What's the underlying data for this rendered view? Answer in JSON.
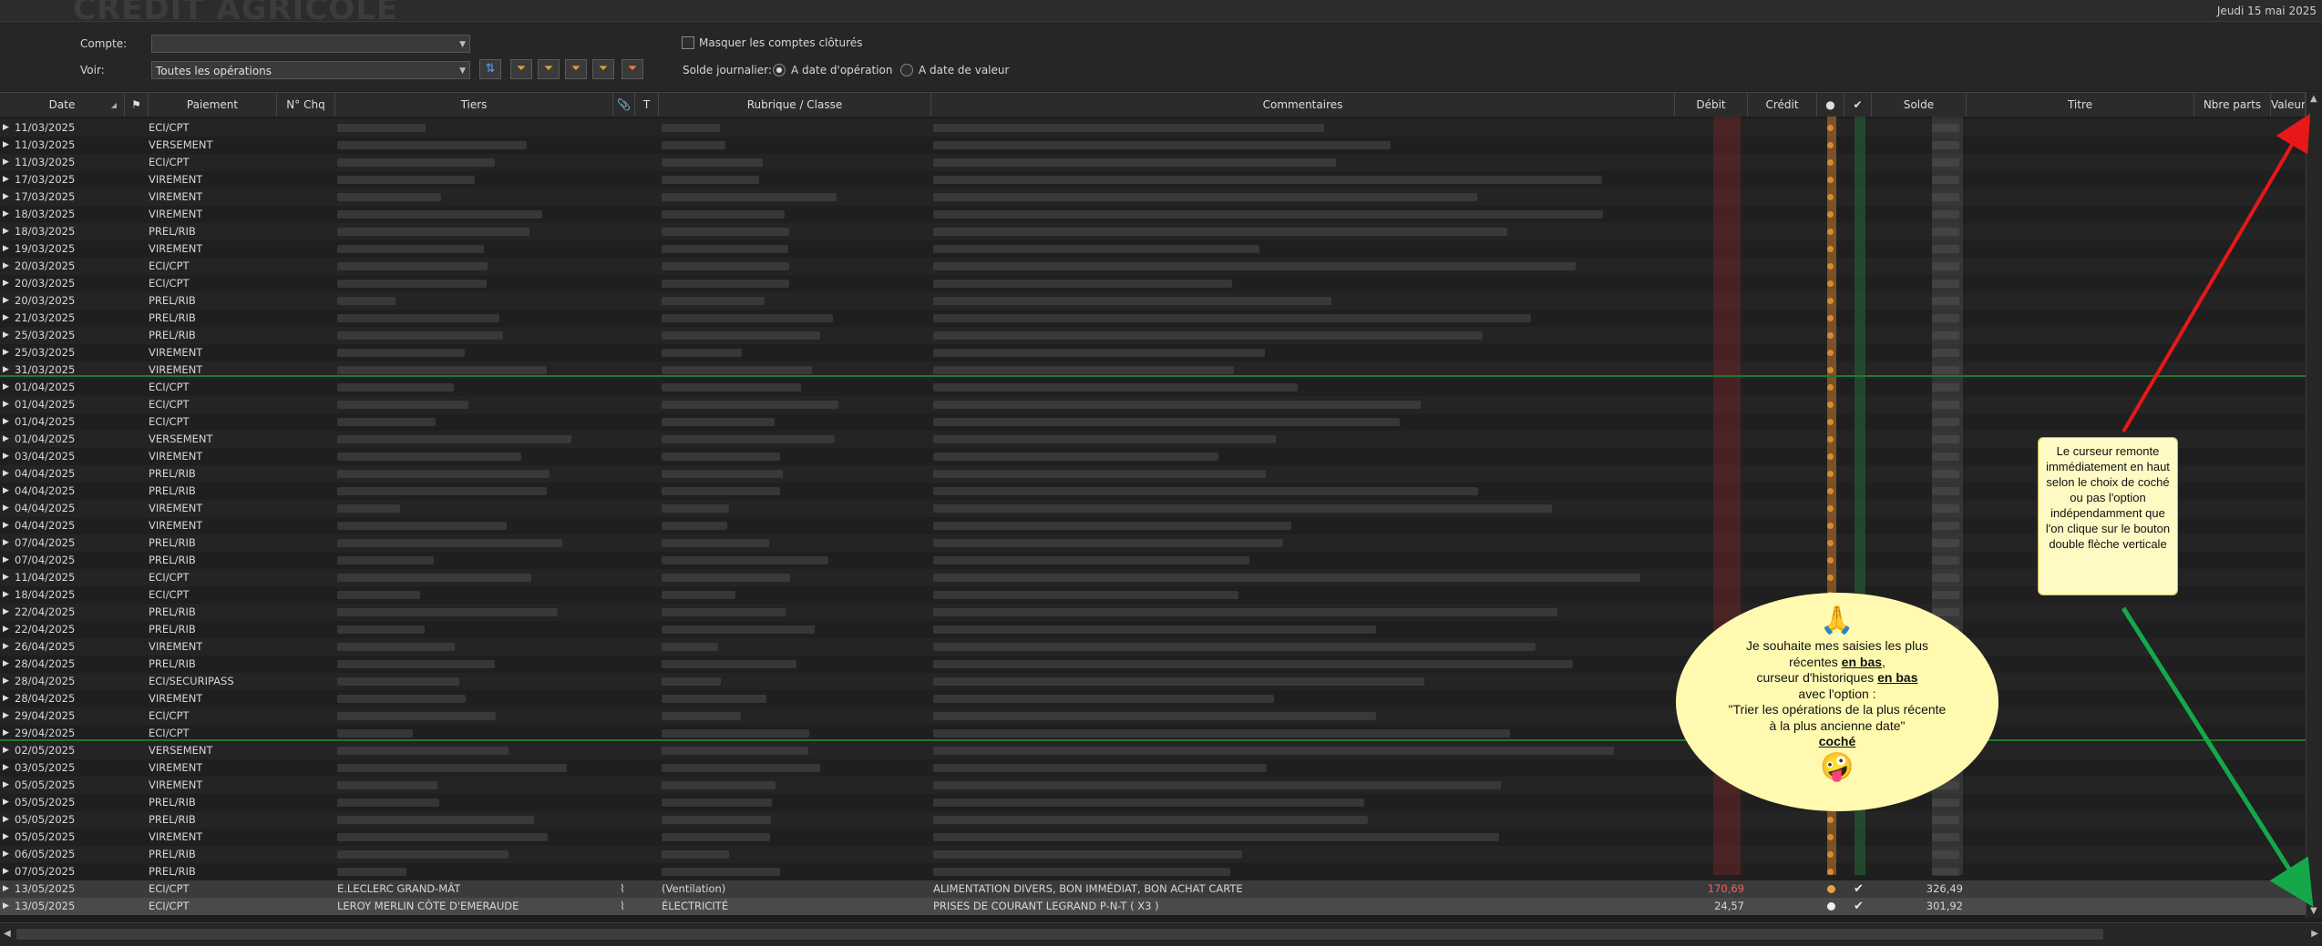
{
  "topbar": {
    "date": "Jeudi 15 mai 2025",
    "watermark": "CRÉDIT AGRICOLE"
  },
  "filters": {
    "compte_label": "Compte:",
    "compte_value": "",
    "voir_label": "Voir:",
    "voir_value": "Toutes les opérations",
    "masquer_label": "Masquer les comptes clôturés",
    "masquer_checked": false,
    "solde_label": "Solde journalier:",
    "radio_operation": "A date d'opération",
    "radio_valeur": "A date de valeur",
    "selected_radio": "A date d'opération"
  },
  "toolbar": {
    "icons": [
      "sort-updown-icon",
      "filter-add-icon",
      "filter-remove-icon",
      "filter-edit-icon",
      "filter-funnel-icon",
      "filter-clear-icon"
    ]
  },
  "columns": [
    "Date",
    "",
    "Paiement",
    "N° Chq",
    "Tiers",
    "",
    "T",
    "Rubrique / Classe",
    "Commentaires",
    "Débit",
    "Crédit",
    "●",
    "✔",
    "Solde",
    "Titre",
    "Nbre parts",
    "Valeur"
  ],
  "rows": [
    {
      "date": "11/03/2025",
      "pay": "ECI/CPT"
    },
    {
      "date": "11/03/2025",
      "pay": "VERSEMENT"
    },
    {
      "date": "11/03/2025",
      "pay": "ECI/CPT"
    },
    {
      "date": "17/03/2025",
      "pay": "VIREMENT"
    },
    {
      "date": "17/03/2025",
      "pay": "VIREMENT"
    },
    {
      "date": "18/03/2025",
      "pay": "VIREMENT"
    },
    {
      "date": "18/03/2025",
      "pay": "PREL/RIB"
    },
    {
      "date": "19/03/2025",
      "pay": "VIREMENT"
    },
    {
      "date": "20/03/2025",
      "pay": "ECI/CPT"
    },
    {
      "date": "20/03/2025",
      "pay": "ECI/CPT"
    },
    {
      "date": "20/03/2025",
      "pay": "PREL/RIB"
    },
    {
      "date": "21/03/2025",
      "pay": "PREL/RIB"
    },
    {
      "date": "25/03/2025",
      "pay": "PREL/RIB"
    },
    {
      "date": "25/03/2025",
      "pay": "VIREMENT"
    },
    {
      "date": "31/03/2025",
      "pay": "VIREMENT"
    },
    {
      "date": "01/04/2025",
      "pay": "ECI/CPT"
    },
    {
      "date": "01/04/2025",
      "pay": "ECI/CPT"
    },
    {
      "date": "01/04/2025",
      "pay": "ECI/CPT"
    },
    {
      "date": "01/04/2025",
      "pay": "VERSEMENT"
    },
    {
      "date": "03/04/2025",
      "pay": "VIREMENT"
    },
    {
      "date": "04/04/2025",
      "pay": "PREL/RIB"
    },
    {
      "date": "04/04/2025",
      "pay": "PREL/RIB"
    },
    {
      "date": "04/04/2025",
      "pay": "VIREMENT"
    },
    {
      "date": "04/04/2025",
      "pay": "VIREMENT"
    },
    {
      "date": "07/04/2025",
      "pay": "PREL/RIB"
    },
    {
      "date": "07/04/2025",
      "pay": "PREL/RIB"
    },
    {
      "date": "11/04/2025",
      "pay": "ECI/CPT"
    },
    {
      "date": "18/04/2025",
      "pay": "ECI/CPT"
    },
    {
      "date": "22/04/2025",
      "pay": "PREL/RIB"
    },
    {
      "date": "22/04/2025",
      "pay": "PREL/RIB"
    },
    {
      "date": "26/04/2025",
      "pay": "VIREMENT"
    },
    {
      "date": "28/04/2025",
      "pay": "PREL/RIB"
    },
    {
      "date": "28/04/2025",
      "pay": "ECI/SECURIPASS"
    },
    {
      "date": "28/04/2025",
      "pay": "VIREMENT"
    },
    {
      "date": "29/04/2025",
      "pay": "ECI/CPT"
    },
    {
      "date": "29/04/2025",
      "pay": "ECI/CPT"
    },
    {
      "date": "02/05/2025",
      "pay": "VERSEMENT"
    },
    {
      "date": "03/05/2025",
      "pay": "VIREMENT"
    },
    {
      "date": "05/05/2025",
      "pay": "VIREMENT"
    },
    {
      "date": "05/05/2025",
      "pay": "PREL/RIB"
    },
    {
      "date": "05/05/2025",
      "pay": "PREL/RIB"
    },
    {
      "date": "05/05/2025",
      "pay": "VIREMENT"
    },
    {
      "date": "06/05/2025",
      "pay": "PREL/RIB"
    },
    {
      "date": "07/05/2025",
      "pay": "PREL/RIB"
    },
    {
      "date": "13/05/2025",
      "pay": "ECI/CPT",
      "tiers": "E.LECLERC GRAND-MÂT",
      "rub": "(Ventilation)",
      "com": "ALIMENTATION DIVERS, BON IMMÉDIAT, BON ACHAT CARTE",
      "debit": "170,69",
      "solde": "326,49",
      "debit_red": true,
      "dot": "#e8a23a"
    },
    {
      "date": "13/05/2025",
      "pay": "ECI/CPT",
      "tiers": "LEROY MERLIN CÔTE D'EMERAUDE",
      "rub": "ÉLECTRICITÉ",
      "com": "PRISES DE COURANT LEGRAND P-N-T ( X3 )",
      "debit": "24,57",
      "solde": "301,92",
      "debit_red": false,
      "dot": "#f0f0f0"
    }
  ],
  "notes": {
    "box": "Le curseur remonte immédiatement en haut selon le choix de coché ou pas l'option indépendamment que l'on clique sur le bouton double flèche verticale",
    "bubble_emoji_top": "🙏",
    "bubble_line1": "Je souhaite mes saisies les plus récentes ",
    "bubble_bold1": "en bas",
    "bubble_line2": "curseur d'historiques ",
    "bubble_bold2": "en bas",
    "bubble_line3": "avec l'option :",
    "bubble_line4": "\"Trier les opérations de la plus récente à la plus ancienne date\"",
    "bubble_bold3": "coché",
    "bubble_emoji_bottom": "🤪",
    "colors": {
      "up_arrow": "#e81818",
      "down_arrow": "#15a84a",
      "note_bg": "#fff9c4",
      "bubble_bg": "#fffab0"
    }
  }
}
